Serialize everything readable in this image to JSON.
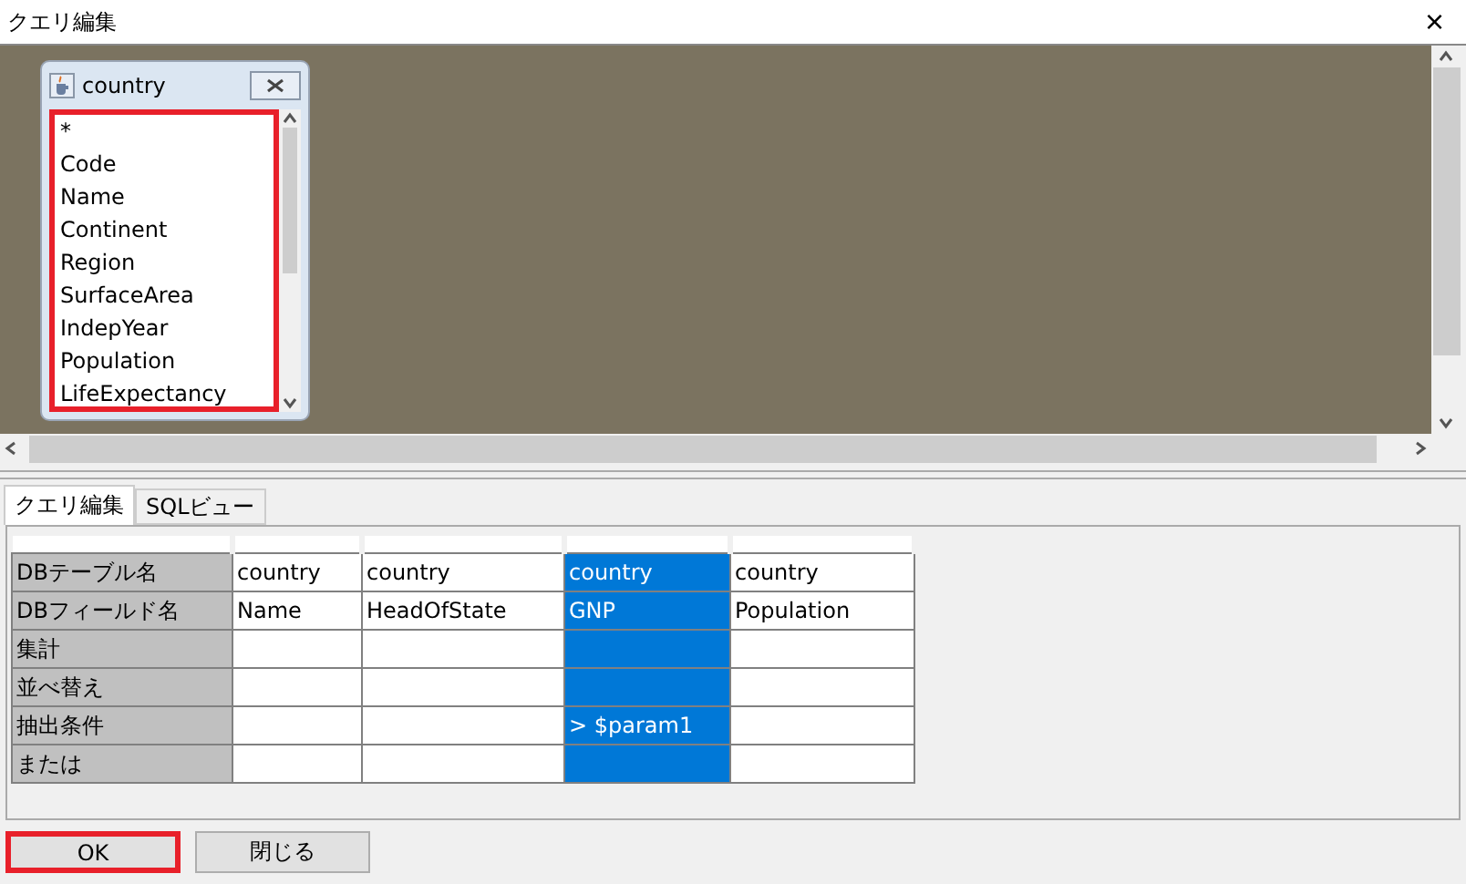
{
  "window": {
    "title": "クエリ編集",
    "close": "×"
  },
  "table_window": {
    "title": "country",
    "fields": [
      "*",
      "Code",
      "Name",
      "Continent",
      "Region",
      "SurfaceArea",
      "IndepYear",
      "Population",
      "LifeExpectancy"
    ]
  },
  "tabs": [
    {
      "label": "クエリ編集",
      "selected": true
    },
    {
      "label": "SQLビュー",
      "selected": false
    }
  ],
  "grid": {
    "rows": [
      {
        "label": "DBテーブル名"
      },
      {
        "label": "DBフィールド名"
      },
      {
        "label": "集計"
      },
      {
        "label": "並べ替え"
      },
      {
        "label": "抽出条件"
      },
      {
        "label": "または"
      }
    ],
    "columns": [
      {
        "selected": false,
        "table_name": "country",
        "field_name": "Name"
      },
      {
        "selected": false,
        "table_name": "country",
        "field_name": "HeadOfState"
      },
      {
        "selected": true,
        "table_name": "country",
        "field_name": "GNP",
        "criteria": "> $param1"
      },
      {
        "selected": false,
        "table_name": "country",
        "field_name": "Population"
      }
    ]
  },
  "buttons": [
    {
      "label": "OK",
      "focused": true
    },
    {
      "label": "閉じる",
      "focused": false
    }
  ]
}
